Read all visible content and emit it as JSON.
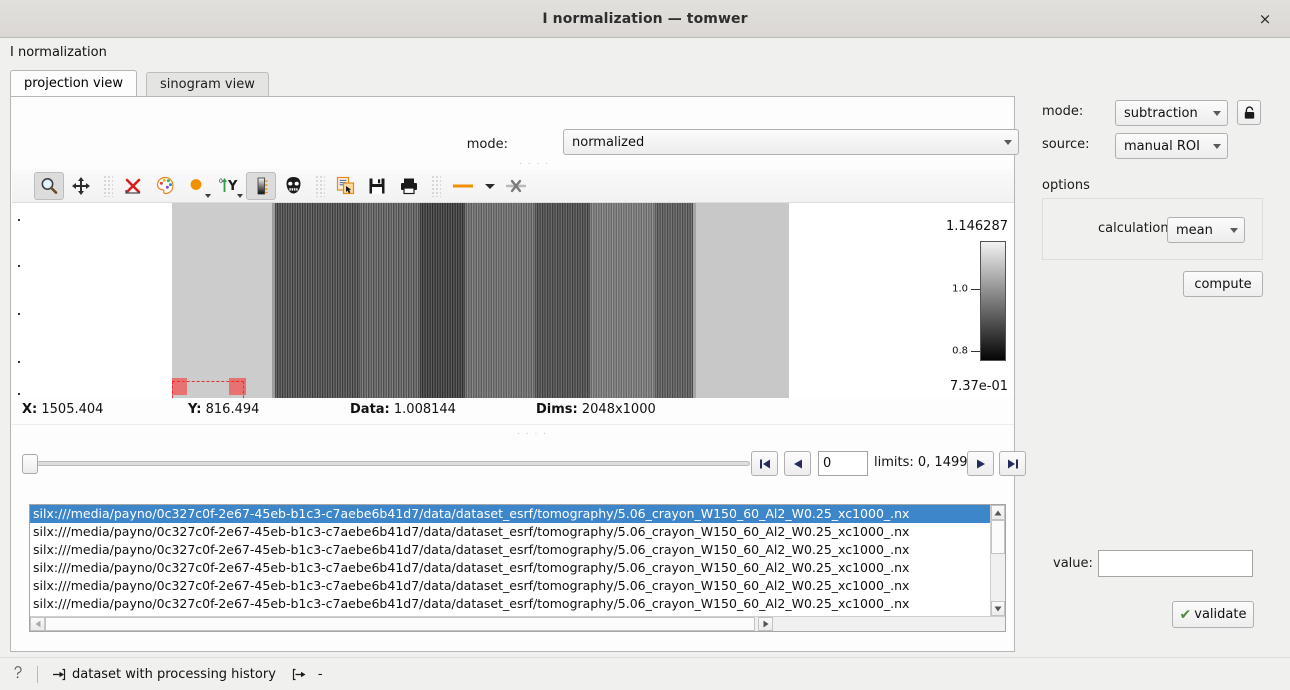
{
  "window": {
    "title": "I normalization — tomwer",
    "close_label": "×",
    "header_label": "I normalization"
  },
  "tabs": [
    {
      "label": "projection view",
      "active": true
    },
    {
      "label": "sinogram view",
      "active": false
    }
  ],
  "plot": {
    "mode_label": "mode:",
    "mode_value": "normalized",
    "toolbar": [
      {
        "name": "zoom-icon",
        "checked": true
      },
      {
        "name": "pan-icon",
        "checked": false
      },
      {
        "name": "reset-zoom-icon",
        "checked": false
      },
      {
        "name": "color-palette-icon",
        "checked": false
      },
      {
        "name": "marker-color-icon",
        "checked": false
      },
      {
        "name": "y-axis-direction-icon",
        "checked": false
      },
      {
        "name": "colormap-icon",
        "checked": true
      },
      {
        "name": "mask-icon",
        "checked": false
      },
      {
        "name": "copy-to-clipboard-icon",
        "checked": false
      },
      {
        "name": "save-icon",
        "checked": false
      },
      {
        "name": "print-icon",
        "checked": false
      },
      {
        "name": "line-style-icon",
        "checked": false
      },
      {
        "name": "clear-markers-icon",
        "checked": false
      }
    ],
    "colorbar": {
      "max": "1.146287",
      "min": "7.37e-01",
      "ticks": [
        "1.0",
        "0.8"
      ]
    },
    "coords": {
      "x_key": "X:",
      "x_val": "1505.404",
      "y_key": "Y:",
      "y_val": "816.494",
      "data_key": "Data:",
      "data_val": "1.008144",
      "dims_key": "Dims:",
      "dims_val": "2048x1000"
    }
  },
  "frame_nav": {
    "first_label": "|◀",
    "prev_label": "◀",
    "value": "0",
    "limits": "limits: 0, 1499",
    "next_label": "▶",
    "last_label": "▶|"
  },
  "file_list": {
    "items": [
      {
        "text": "silx:///media/payno/0c327c0f-2e67-45eb-b1c3-c7aebe6b41d7/data/dataset_esrf/tomography/5.06_crayon_W150_60_Al2_W0.25_xc1000_.nx",
        "selected": true
      },
      {
        "text": "silx:///media/payno/0c327c0f-2e67-45eb-b1c3-c7aebe6b41d7/data/dataset_esrf/tomography/5.06_crayon_W150_60_Al2_W0.25_xc1000_.nx",
        "selected": false
      },
      {
        "text": "silx:///media/payno/0c327c0f-2e67-45eb-b1c3-c7aebe6b41d7/data/dataset_esrf/tomography/5.06_crayon_W150_60_Al2_W0.25_xc1000_.nx",
        "selected": false
      },
      {
        "text": "silx:///media/payno/0c327c0f-2e67-45eb-b1c3-c7aebe6b41d7/data/dataset_esrf/tomography/5.06_crayon_W150_60_Al2_W0.25_xc1000_.nx",
        "selected": false
      },
      {
        "text": "silx:///media/payno/0c327c0f-2e67-45eb-b1c3-c7aebe6b41d7/data/dataset_esrf/tomography/5.06_crayon_W150_60_Al2_W0.25_xc1000_.nx",
        "selected": false
      },
      {
        "text": "silx:///media/payno/0c327c0f-2e67-45eb-b1c3-c7aebe6b41d7/data/dataset_esrf/tomography/5.06_crayon_W150_60_Al2_W0.25_xc1000_.nx",
        "selected": false
      }
    ]
  },
  "right_panel": {
    "mode_label": "mode:",
    "mode_value": "subtraction",
    "lock_icon": "lock-icon",
    "source_label": "source:",
    "source_value": "manual ROI",
    "options_label": "options",
    "calc_label": "calculation fct",
    "calc_value": "mean",
    "compute_label": "compute",
    "value_label": "value:",
    "value_text": "",
    "value_placeholder": "",
    "validate_label": "validate"
  },
  "statusbar": {
    "help_icon": "help-icon",
    "dataset_icon": "input-arrow-icon",
    "dataset_text": "dataset with processing history",
    "output_icon": "output-arrow-icon",
    "output_text": "-"
  },
  "colors": {
    "selection_blue": "#3d86c9",
    "roi_red": "#e03030",
    "accent_orange": "#f29100",
    "check_green": "#4f8b3b"
  }
}
